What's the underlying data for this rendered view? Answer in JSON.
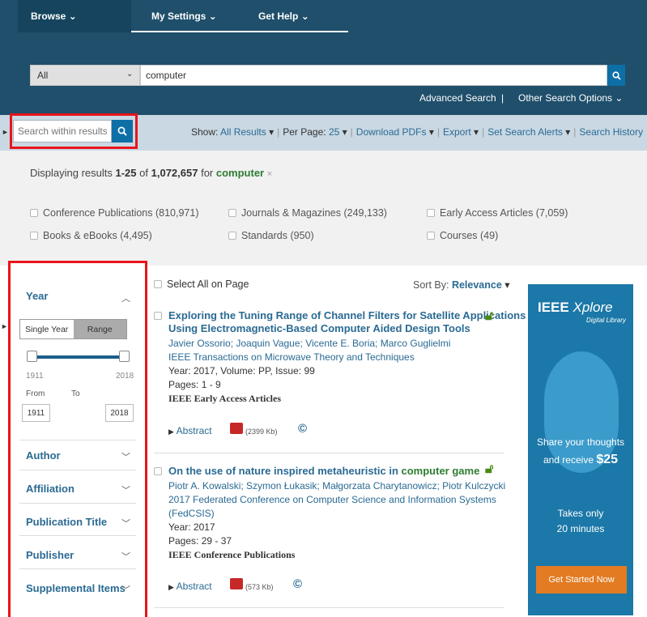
{
  "topnav": {
    "browse": "Browse",
    "my_settings": "My Settings",
    "get_help": "Get Help"
  },
  "search": {
    "scope": "All",
    "query": "computer",
    "advanced": "Advanced Search",
    "separator": "|",
    "other": "Other Search Options"
  },
  "filterbar": {
    "search_within_placeholder": "Search within results",
    "show_label": "Show:",
    "show_value": "All Results",
    "per_page_label": "Per Page:",
    "per_page_value": "25",
    "download_pdfs": "Download PDFs",
    "export": "Export",
    "set_alerts": "Set Search Alerts",
    "history": "Search History"
  },
  "results_summary": {
    "prefix": "Displaying results",
    "range": "1-25",
    "of": "of",
    "total": "1,072,657",
    "for": "for",
    "query": "computer",
    "clear": "×"
  },
  "content_types": [
    "Conference Publications (810,971)",
    "Journals & Magazines (249,133)",
    "Early Access Articles (7,059)",
    "Books & eBooks (4,495)",
    "Standards (950)",
    "Courses (49)"
  ],
  "sidebar": {
    "year": "Year",
    "single_year": "Single Year",
    "range": "Range",
    "min_year": "1911",
    "max_year": "2018",
    "from": "From",
    "to": "To",
    "from_value": "1911",
    "to_value": "2018",
    "facets": [
      "Author",
      "Affiliation",
      "Publication Title",
      "Publisher",
      "Supplemental Items"
    ]
  },
  "results": {
    "select_all": "Select All on Page",
    "sort_label": "Sort By:",
    "sort_value": "Relevance",
    "items": [
      {
        "title_line1": "Exploring the Tuning Range of Channel Filters for Satellite Applications",
        "title_line2a": "Using Electromagnetic-Based ",
        "title_line2b": "Computer",
        "title_line2c": " Aided Design Tools",
        "authors": "Javier Ossorio; Joaquin Vague; Vicente E. Boria; Marco Guglielmi",
        "publication": "IEEE Transactions on Microwave Theory and Techniques",
        "year_info": "Year: 2017, Volume: PP, Issue: 99",
        "pages": "Pages: 1 - 9",
        "type": "IEEE Early Access Articles",
        "abstract": "Abstract",
        "pdf_size": "(2399 Kb)"
      },
      {
        "title_a": "On the use of nature inspired metaheuristic in ",
        "title_b": "computer game",
        "authors": "Piotr A. Kowalski; Szymon Łukasik; Małgorzata Charytanowicz; Piotr Kulczycki",
        "publication_line1": "2017 Federated Conference on Computer Science and Information Systems",
        "publication_line2": "(FedCSIS)",
        "year_info": "Year: 2017",
        "pages": "Pages: 29 - 37",
        "type": "IEEE Conference Publications",
        "abstract": "Abstract",
        "pdf_size": "(573 Kb)"
      }
    ]
  },
  "ad": {
    "brand": "IEEE",
    "brand_italic": "Xplore",
    "brand_sub": "Digital Library",
    "line1": "Share your thoughts",
    "line2a": "and receive ",
    "line2b": "$25",
    "line3": "Takes only",
    "line4": "20 minutes",
    "button": "Get Started Now"
  },
  "colors": {
    "nav_bg": "#1f4f6b",
    "link": "#2a6a93",
    "highlight": "#2e7d32",
    "annotation_red": "#e8141a",
    "ad_bg": "#1b78a8",
    "ad_button": "#e37b22"
  }
}
